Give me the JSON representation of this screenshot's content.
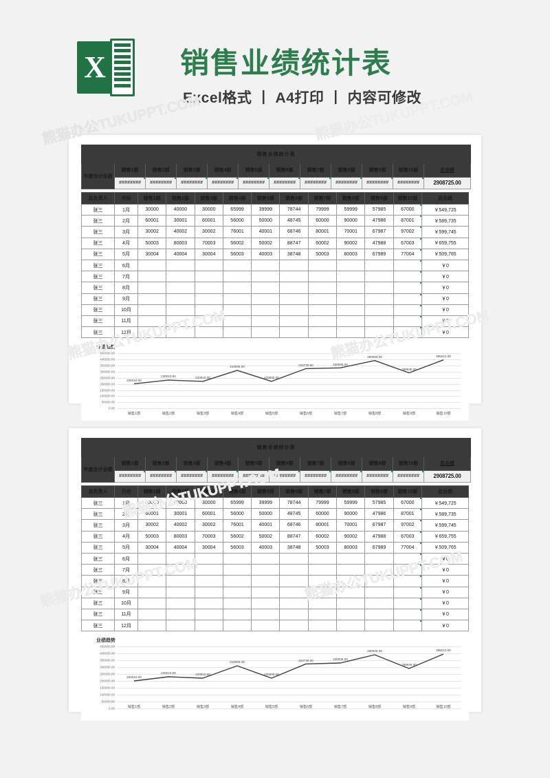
{
  "header": {
    "logo_letter": "X",
    "title": "销售业绩统计表",
    "subtitle": "Excel格式 丨 A4打印 丨 内容可修改"
  },
  "watermark": {
    "text": "熊猫办公TUKUPPT.COM"
  },
  "sheet": {
    "banner_title": "销售业绩统计表",
    "summary": {
      "row_label": "年度合计业绩",
      "dept_headers": [
        "销售1部",
        "销售2部",
        "销售3部",
        "销售4部",
        "销售5部",
        "销售6部",
        "销售7部",
        "销售8部",
        "销售9部",
        "销售10部"
      ],
      "total_header": "总业绩",
      "dept_values": [
        "########",
        "########",
        "########",
        "########",
        "########",
        "########",
        "########",
        "########",
        "########",
        "########"
      ],
      "total_value": "2908725.00"
    },
    "table": {
      "columns": [
        "总负责人",
        "月份",
        "销售1部",
        "销售2部",
        "销售3部",
        "销售4部",
        "销售5部",
        "销售6部",
        "销售7部",
        "销售8部",
        "销售9部",
        "销售10部",
        "总业绩"
      ],
      "rows": [
        [
          "张三",
          "1月",
          "30000",
          "40000",
          "30000",
          "65999",
          "39999",
          "78744",
          "79999",
          "59999",
          "57985",
          "67000",
          "￥549,725"
        ],
        [
          "张三",
          "2月",
          "60001",
          "30001",
          "60001",
          "56000",
          "50000",
          "48745",
          "60000",
          "90000",
          "47986",
          "87001",
          "￥589,735"
        ],
        [
          "张三",
          "3月",
          "30002",
          "40002",
          "30002",
          "76001",
          "40001",
          "68746",
          "80001",
          "70001",
          "67987",
          "97002",
          "￥599,745"
        ],
        [
          "张三",
          "4月",
          "50003",
          "80003",
          "70003",
          "56002",
          "50002",
          "88747",
          "60002",
          "90002",
          "47988",
          "67003",
          "￥659,755"
        ],
        [
          "张三",
          "5月",
          "30004",
          "40004",
          "30004",
          "56003",
          "40003",
          "38748",
          "50003",
          "80003",
          "67989",
          "77004",
          "￥509,765"
        ],
        [
          "张三",
          "6月",
          "",
          "",
          "",
          "",
          "",
          "",
          "",
          "",
          "",
          "",
          "￥0"
        ],
        [
          "张三",
          "7月",
          "",
          "",
          "",
          "",
          "",
          "",
          "",
          "",
          "",
          "",
          "￥0"
        ],
        [
          "张三",
          "8月",
          "",
          "",
          "",
          "",
          "",
          "",
          "",
          "",
          "",
          "",
          "￥0"
        ],
        [
          "张三",
          "9月",
          "",
          "",
          "",
          "",
          "",
          "",
          "",
          "",
          "",
          "",
          "￥0"
        ],
        [
          "张三",
          "10月",
          "",
          "",
          "",
          "",
          "",
          "",
          "",
          "",
          "",
          "",
          "￥0"
        ],
        [
          "张三",
          "11月",
          "",
          "",
          "",
          "",
          "",
          "",
          "",
          "",
          "",
          "",
          "￥0"
        ],
        [
          "张三",
          "12月",
          "",
          "",
          "",
          "",
          "",
          "",
          "",
          "",
          "",
          "",
          "￥0"
        ]
      ]
    }
  },
  "chart_data": {
    "type": "line",
    "title": "业绩趋势",
    "xlabel": "",
    "ylabel": "",
    "grid": true,
    "legend": "none",
    "categories": [
      "销售1部",
      "销售2部",
      "销售3部",
      "销售4部",
      "销售5部",
      "销售6部",
      "销售7部",
      "销售8部",
      "销售9部",
      "销售10部"
    ],
    "values": [
      200010.0,
      230010.0,
      220010.0,
      310005.0,
      220005.0,
      323730.0,
      330005.0,
      390005.0,
      289935.0,
      395010.0
    ],
    "data_labels": [
      "200010.00",
      "230010.00",
      "220010.00",
      "310005.00",
      "220005.00",
      "323730.00",
      "330005.00",
      "390005.00",
      "289935.00",
      "395010.00"
    ],
    "ylim": [
      0,
      450000
    ],
    "yticks": [
      0,
      50000,
      100000,
      150000,
      200000,
      250000,
      300000,
      350000,
      400000,
      450000
    ],
    "ytick_labels": [
      "0.00",
      "50000.00",
      "100000.00",
      "150000.00",
      "200000.00",
      "250000.00",
      "300000.00",
      "350000.00",
      "400000.00",
      "450000.00"
    ],
    "line_color": "#3f3f3f"
  },
  "colors": {
    "brand_green": "#217346",
    "title_green": "#2e7d4f",
    "header_dark": "#3a3a3a",
    "page_bg": "#f2f2f2"
  }
}
